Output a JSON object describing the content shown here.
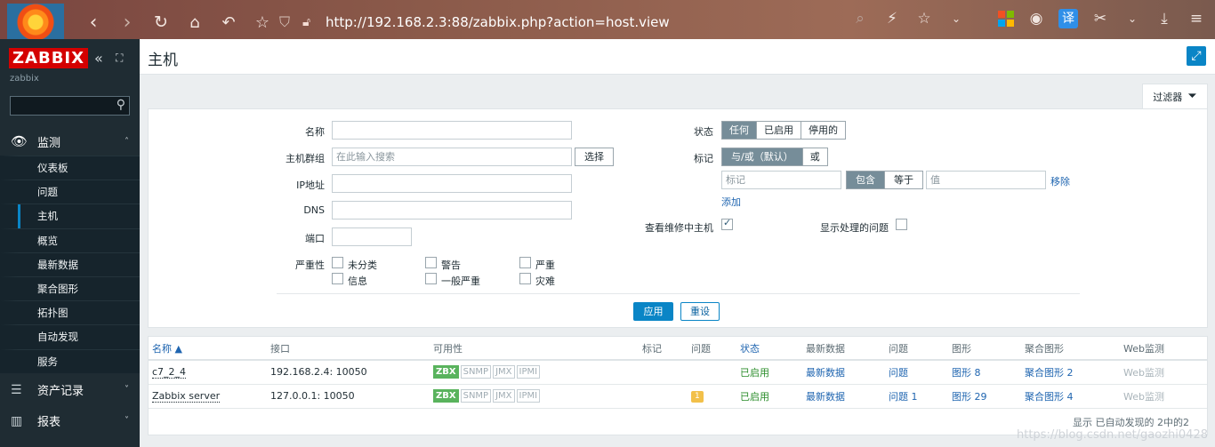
{
  "browser": {
    "url": "http://192.168.2.3:88/zabbix.php?action=host.view",
    "translate_label": "译"
  },
  "sidebar": {
    "brand": "ZABBIX",
    "server_name": "zabbix",
    "monitoring_label": "监测",
    "submenu": [
      "仪表板",
      "问题",
      "主机",
      "概览",
      "最新数据",
      "聚合图形",
      "拓扑图",
      "自动发现",
      "服务"
    ],
    "inventory_label": "资产记录",
    "reports_label": "报表"
  },
  "header": {
    "title": "主机"
  },
  "filter": {
    "tab_label": "过滤器",
    "name_label": "名称",
    "host_groups_label": "主机群组",
    "host_groups_placeholder": "在此输入搜索",
    "select_button": "选择",
    "ip_label": "IP地址",
    "dns_label": "DNS",
    "port_label": "端口",
    "severity_label": "严重性",
    "severities": [
      "未分类",
      "警告",
      "严重",
      "信息",
      "一般严重",
      "灾难"
    ],
    "status_label": "状态",
    "status_options": [
      "任何",
      "已启用",
      "停用的"
    ],
    "tags_label": "标记",
    "tag_mode_options": [
      "与/或（默认）",
      "或"
    ],
    "tag_placeholder": "标记",
    "tag_operator_options": [
      "包含",
      "等于"
    ],
    "value_placeholder": "值",
    "remove_link": "移除",
    "add_link": "添加",
    "maintenance_label": "查看维修中主机",
    "suppressed_label": "显示处理的问题",
    "apply_button": "应用",
    "reset_button": "重设"
  },
  "table": {
    "headers": [
      "名称 ▲",
      "接口",
      "可用性",
      "标记",
      "问题",
      "状态",
      "最新数据",
      "问题",
      "图形",
      "聚合图形",
      "Web监测"
    ],
    "rows": [
      {
        "name": "c7_2_4",
        "interface": "192.168.2.4: 10050",
        "availability": [
          "ZBX",
          "SNMP",
          "JMX",
          "IPMI"
        ],
        "tags": "",
        "problems": "",
        "status": "已启用",
        "latest": "最新数据",
        "problems_link": "问题",
        "graphs": "图形 8",
        "screens": "聚合图形 2",
        "web": "Web监测"
      },
      {
        "name": "Zabbix server",
        "interface": "127.0.0.1: 10050",
        "availability": [
          "ZBX",
          "SNMP",
          "JMX",
          "IPMI"
        ],
        "tags": "",
        "problems": "1",
        "status": "已启用",
        "latest": "最新数据",
        "problems_link": "问题 1",
        "graphs": "图形 29",
        "screens": "聚合图形 4",
        "web": "Web监测"
      }
    ],
    "footer": "显示 已自动发现的 2中的2"
  },
  "watermark": "https://blog.csdn.net/gaozhi0428",
  "colors": {
    "accent": "#0a85c6",
    "sidebar": "#1f2c33",
    "brand_red": "#d40000",
    "enabled_green": "#2a8c2a"
  }
}
